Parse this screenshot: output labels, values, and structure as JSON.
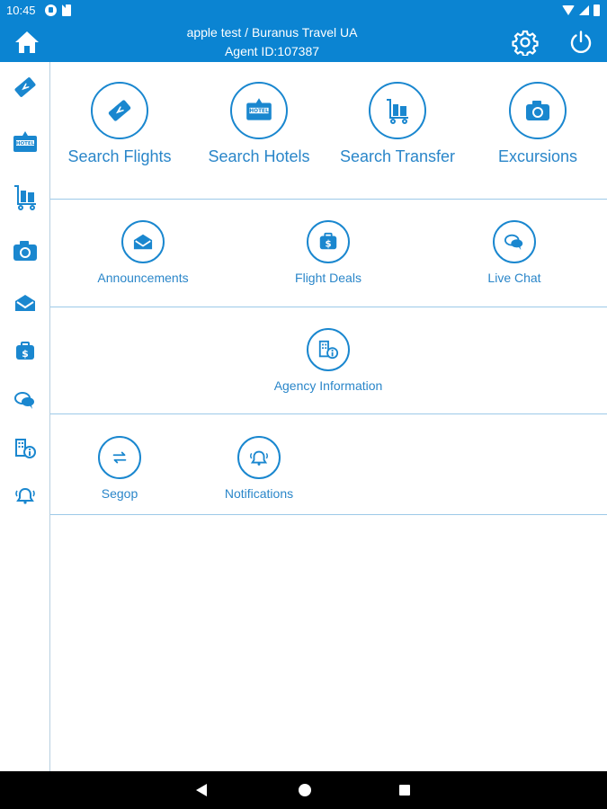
{
  "status_bar": {
    "time": "10:45"
  },
  "app_bar": {
    "title_line1": "apple test / Buranus Travel UA",
    "title_line2": "Agent ID:107387"
  },
  "colors": {
    "primary": "#0b84d2",
    "accent_text": "#2a86c9",
    "divider": "#9cc9e8"
  },
  "sidebar": {
    "items": [
      {
        "icon": "flight-ticket-icon"
      },
      {
        "icon": "hotel-icon"
      },
      {
        "icon": "luggage-cart-icon"
      },
      {
        "icon": "camera-icon"
      },
      {
        "icon": "envelope-icon"
      },
      {
        "icon": "deals-tag-icon"
      },
      {
        "icon": "chat-bubble-icon"
      },
      {
        "icon": "agency-info-icon"
      },
      {
        "icon": "notification-bell-icon"
      }
    ]
  },
  "main": {
    "row1": [
      {
        "label": "Search Flights",
        "icon": "flight-ticket-icon"
      },
      {
        "label": "Search Hotels",
        "icon": "hotel-icon"
      },
      {
        "label": "Search Transfer",
        "icon": "luggage-cart-icon"
      },
      {
        "label": "Excursions",
        "icon": "camera-icon"
      }
    ],
    "row2": [
      {
        "label": "Announcements",
        "icon": "envelope-icon"
      },
      {
        "label": "Flight Deals",
        "icon": "deals-tag-icon"
      },
      {
        "label": "Live Chat",
        "icon": "chat-bubble-icon"
      }
    ],
    "row3": [
      {
        "label": "Agency Information",
        "icon": "agency-info-icon"
      }
    ],
    "row4": [
      {
        "label": "Segop",
        "icon": "exchange-arrows-icon"
      },
      {
        "label": "Notifications",
        "icon": "notification-bell-icon"
      }
    ]
  }
}
